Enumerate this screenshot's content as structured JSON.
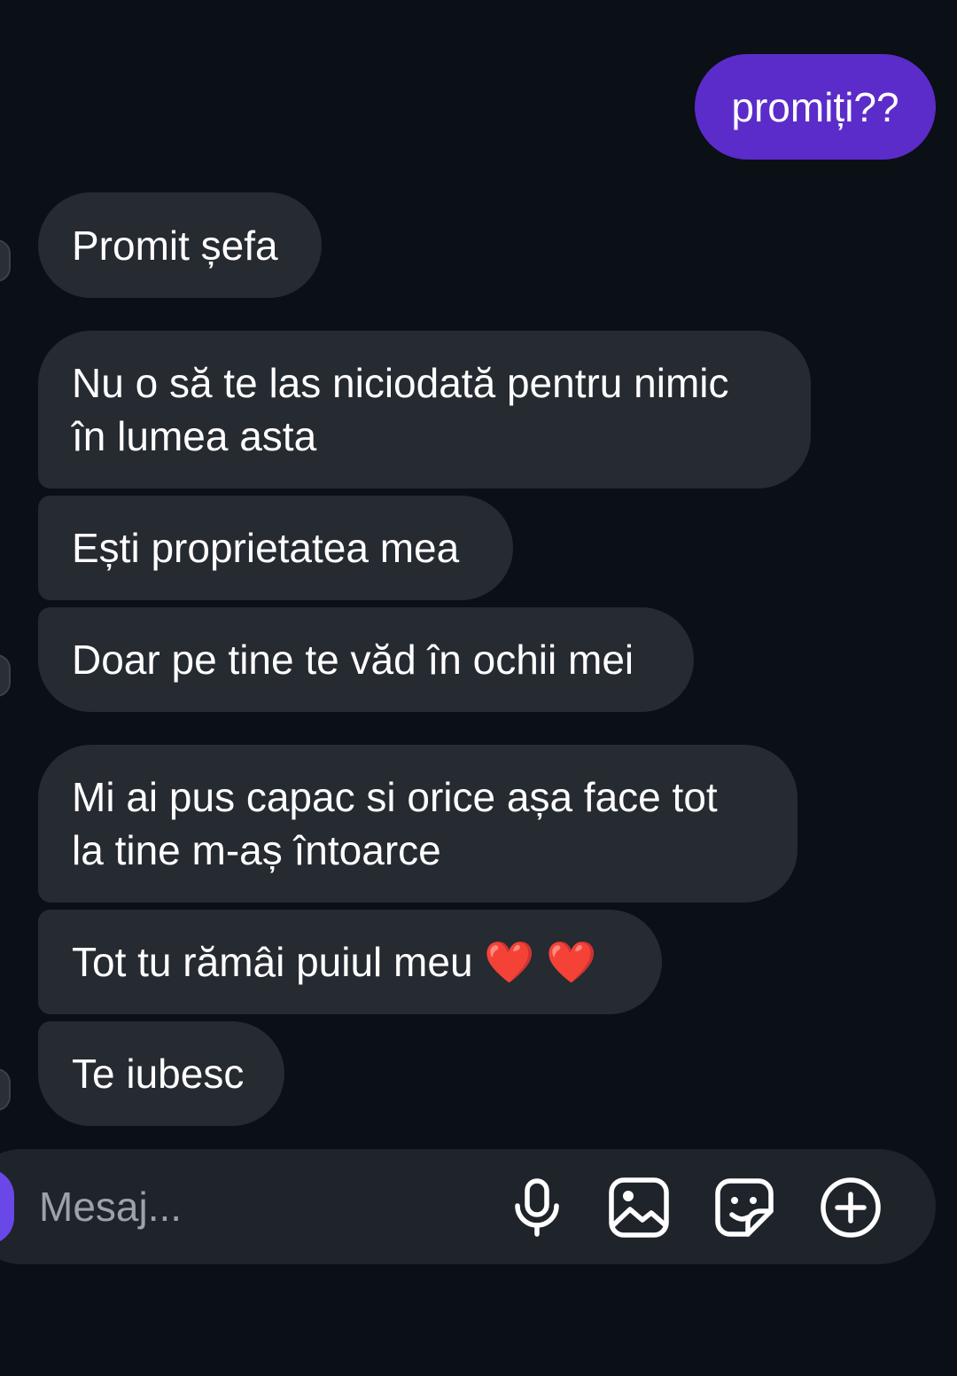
{
  "messages": [
    {
      "direction": "outgoing",
      "text": "promiți??"
    },
    {
      "direction": "incoming",
      "text": "Promit șefa"
    },
    {
      "direction": "incoming",
      "text": "Nu o să te las niciodată pentru nimic\nîn lumea asta"
    },
    {
      "direction": "incoming",
      "text": "Ești proprietatea mea"
    },
    {
      "direction": "incoming",
      "text": "Doar pe tine te văd în ochii mei"
    },
    {
      "direction": "incoming",
      "text": "Mi ai pus capac si orice așa face tot\nla tine m-aș întoarce"
    },
    {
      "direction": "incoming",
      "text": "Tot tu rămâi puiul meu ❤️ ❤️"
    },
    {
      "direction": "incoming",
      "text": "Te iubesc"
    }
  ],
  "composer": {
    "placeholder": "Mesaj...",
    "value": "",
    "icons": [
      "microphone-icon",
      "image-icon",
      "sticker-icon",
      "plus-circle-icon"
    ]
  },
  "colors": {
    "background": "#0b0f16",
    "incoming_bubble": "#262a31",
    "outgoing_bubble": "#5b2cc9",
    "composer": "#1f232a",
    "camera_button": "#6a48e8",
    "placeholder_text": "#9da1a8"
  }
}
